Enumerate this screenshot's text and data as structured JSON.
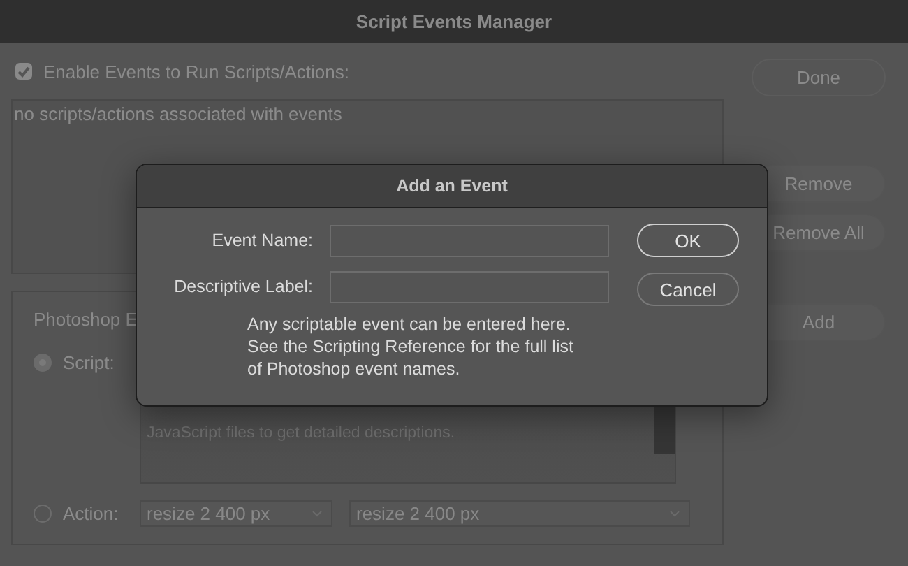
{
  "window": {
    "title": "Script Events Manager"
  },
  "enable_events": {
    "label": "Enable Events to Run Scripts/Actions:",
    "checked": true
  },
  "events_list": {
    "empty_text": "no scripts/actions associated with events"
  },
  "side_buttons": [
    {
      "label": "Done"
    },
    {
      "label": "Remove"
    },
    {
      "label": "Remove All"
    },
    {
      "label": "Add"
    }
  ],
  "group": {
    "title": "Photoshop E",
    "script": {
      "label": "Script:",
      "selected": true
    },
    "description": "JavaScript files to get detailed descriptions.",
    "action": {
      "label": "Action:",
      "selected": false
    },
    "selects": [
      "resize 2 400 px",
      "resize 2 400 px"
    ]
  },
  "dialog": {
    "title": "Add an Event",
    "fields": [
      {
        "label": "Event Name:"
      },
      {
        "label": "Descriptive Label:"
      }
    ],
    "hint": [
      "Any scriptable event can be entered here.",
      "See the Scripting Reference for the full list",
      "of Photoshop event names."
    ],
    "buttons": [
      {
        "label": "OK",
        "default": true
      },
      {
        "label": "Cancel",
        "default": false
      }
    ]
  }
}
